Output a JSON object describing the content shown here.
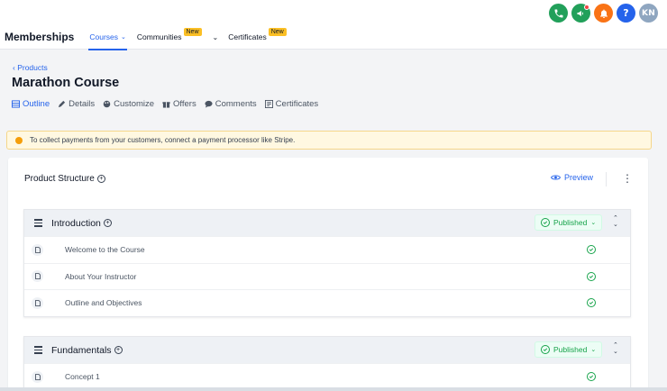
{
  "header": {
    "brand": "Memberships",
    "tabs": [
      {
        "label": "Courses",
        "active": true,
        "has_dropdown": true,
        "badge": ""
      },
      {
        "label": "Communities",
        "active": false,
        "has_dropdown": true,
        "badge": "New"
      },
      {
        "label": "Certificates",
        "active": false,
        "has_dropdown": false,
        "badge": "New"
      }
    ],
    "avatar_initials": "KN",
    "icons": [
      "phone-icon",
      "megaphone-icon",
      "bell-icon",
      "help-icon"
    ],
    "colors": {
      "phone": "#22a05a",
      "megaphone": "#22a05a",
      "bell": "#f97316",
      "help": "#2563eb",
      "accent": "#2563eb"
    }
  },
  "page": {
    "breadcrumb": "Products",
    "title": "Marathon Course",
    "subtabs": [
      {
        "label": "Outline",
        "icon": "outline-icon",
        "active": true
      },
      {
        "label": "Details",
        "icon": "pencil-icon",
        "active": false
      },
      {
        "label": "Customize",
        "icon": "palette-icon",
        "active": false
      },
      {
        "label": "Offers",
        "icon": "gift-icon",
        "active": false
      },
      {
        "label": "Comments",
        "icon": "chat-icon",
        "active": false
      },
      {
        "label": "Certificates",
        "icon": "certificate-icon",
        "active": false
      }
    ],
    "alert": "To collect payments from your customers, connect a payment processor like Stripe."
  },
  "structure": {
    "title": "Product Structure",
    "preview_label": "Preview",
    "sections": [
      {
        "title": "Introduction",
        "status": "Published",
        "lessons": [
          "Welcome to the Course",
          "About Your Instructor",
          "Outline and Objectives"
        ]
      },
      {
        "title": "Fundamentals",
        "status": "Published",
        "lessons": [
          "Concept 1"
        ]
      }
    ]
  }
}
